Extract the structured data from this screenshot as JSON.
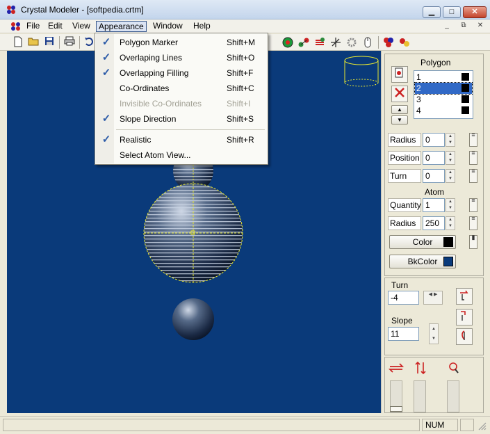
{
  "window": {
    "title": "Crystal Modeler - [softpedia.crtm]",
    "minimize_label": "▁",
    "maximize_label": "□",
    "close_label": "✕",
    "mdi_minimize_label": "_",
    "mdi_restore_label": "⧉",
    "mdi_close_label": "✕"
  },
  "menubar": {
    "items": [
      {
        "label": "File"
      },
      {
        "label": "Edit"
      },
      {
        "label": "View"
      },
      {
        "label": "Appearance"
      },
      {
        "label": "Window"
      },
      {
        "label": "Help"
      }
    ]
  },
  "appearance_menu": {
    "items": [
      {
        "label": "Polygon Marker",
        "shortcut": "Shift+M",
        "checked": "✓"
      },
      {
        "label": "Overlaping Lines",
        "shortcut": "Shift+O",
        "checked": "✓"
      },
      {
        "label": "Overlapping Filling",
        "shortcut": "Shift+F",
        "checked": "✓"
      },
      {
        "label": "Co-Ordinates",
        "shortcut": "Shift+C",
        "checked": ""
      },
      {
        "label": "Invisible Co-Ordinates",
        "shortcut": "Shift+I",
        "checked": ""
      },
      {
        "label": "Slope Direction",
        "shortcut": "Shift+S",
        "checked": "✓"
      },
      {
        "label": "Realistic",
        "shortcut": "Shift+R",
        "checked": "✓"
      },
      {
        "label": "Select Atom View...",
        "shortcut": "",
        "checked": ""
      }
    ]
  },
  "panel": {
    "polygon_header": "Polygon",
    "polygon_list": [
      "1",
      "2",
      "3",
      "4"
    ],
    "selected_polygon": "2",
    "radius_label": "Radius",
    "radius_value": "0",
    "position_label": "Position",
    "position_value": "0",
    "turn_label": "Turn",
    "turn_value": "0",
    "atom_header": "Atom",
    "quantity_label": "Quantity",
    "quantity_value": "1",
    "atom_radius_label": "Radius",
    "atom_radius_value": "250",
    "color_button": "Color",
    "bkcolor_button": "BkColor",
    "view_turn_label": "Turn",
    "view_turn_value": "-4",
    "slope_label": "Slope",
    "slope_value": "11"
  },
  "status": {
    "num": "NUM"
  },
  "colors": {
    "canvas_bg": "#0a3a7a",
    "color_swatch": "#000000",
    "bkcolor_swatch": "#0a3a7a",
    "selection": "#3169c6"
  }
}
